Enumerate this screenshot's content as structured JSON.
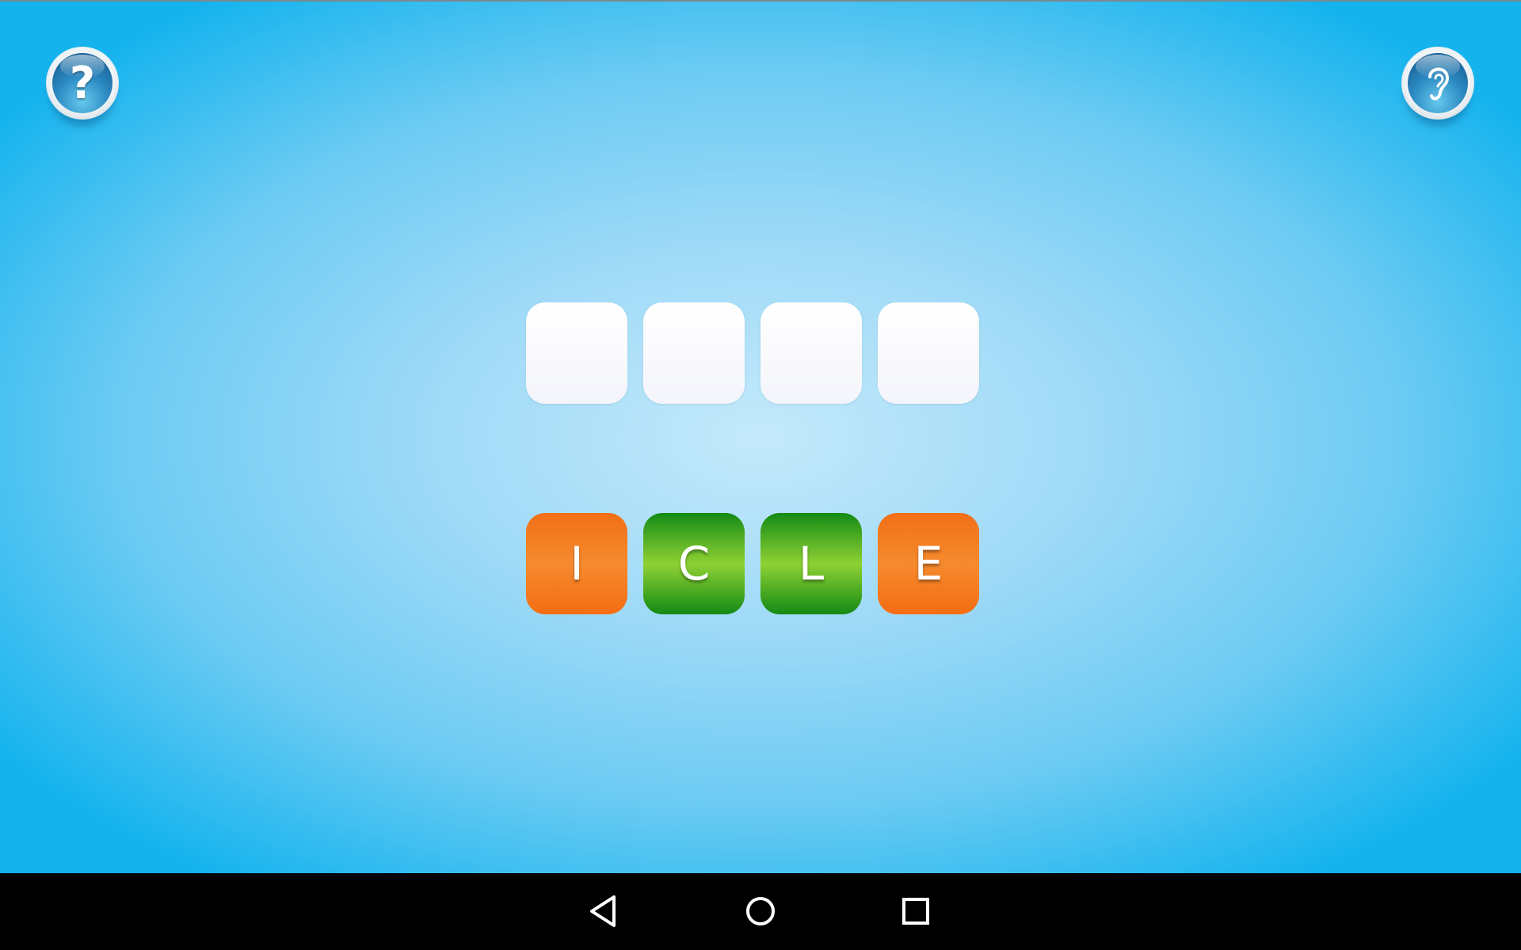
{
  "app": {
    "help_icon": "question-mark-icon",
    "help_glyph": "?",
    "listen_icon": "ear-icon"
  },
  "answer_slots": [
    "",
    "",
    "",
    ""
  ],
  "letter_tiles": [
    {
      "letter": "I",
      "color": "#f47c20"
    },
    {
      "letter": "C",
      "color": "#3aa31f"
    },
    {
      "letter": "L",
      "color": "#3aa31f"
    },
    {
      "letter": "E",
      "color": "#f47c20"
    }
  ],
  "nav": {
    "back_icon": "back-triangle-icon",
    "home_icon": "home-circle-icon",
    "recents_icon": "recents-square-icon"
  }
}
